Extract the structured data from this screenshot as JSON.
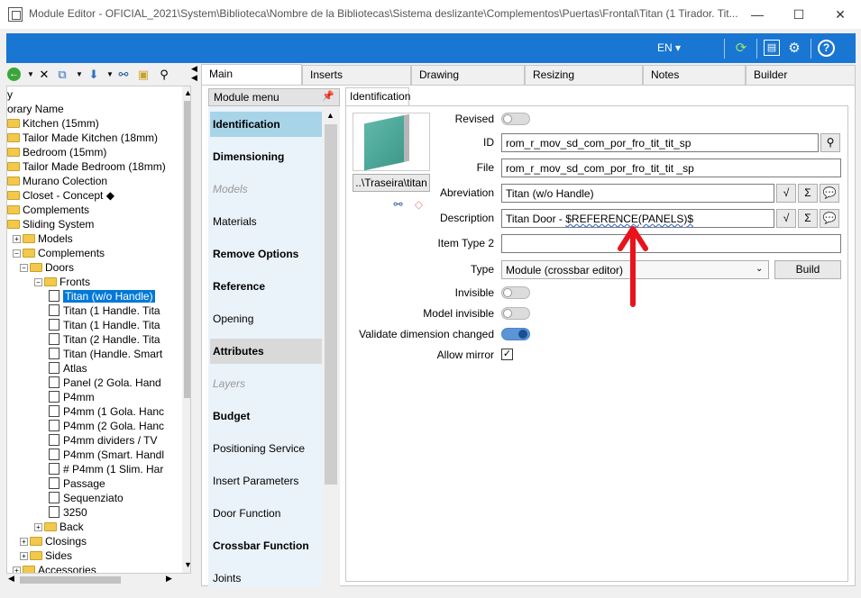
{
  "window": {
    "title": "Module Editor - OFICIAL_2021\\System\\Biblioteca\\Nombre de la Bibliotecas\\Sistema deslizante\\Complementos\\Puertas\\Frontal\\Titan (1 Tirador. Tit...",
    "minimize": "—",
    "maximize": "☐",
    "close": "✕"
  },
  "ribbon": {
    "language": "EN ▾",
    "refresh_icon": "refresh-icon",
    "layout_icon": "layout-icon",
    "settings_icon": "gears-icon",
    "help_icon": "help-icon"
  },
  "left_toolbar": {
    "icons": [
      "back-arrow-icon",
      "dropdown-icon",
      "delete-icon",
      "copy-icon",
      "dropdown-icon",
      "move-down-icon",
      "dropdown-icon",
      "binoculars-icon",
      "folder-refresh-icon",
      "tree-icon"
    ]
  },
  "tree": {
    "items": [
      {
        "label": "y",
        "indent": 0,
        "icon": "none"
      },
      {
        "label": "orary Name",
        "indent": 0,
        "icon": "none"
      },
      {
        "label": "Kitchen (15mm)",
        "indent": 0,
        "icon": "folder"
      },
      {
        "label": "Tailor Made Kitchen (18mm)",
        "indent": 0,
        "icon": "folder"
      },
      {
        "label": "Bedroom (15mm)",
        "indent": 0,
        "icon": "folder"
      },
      {
        "label": "Tailor Made Bedroom (18mm)",
        "indent": 0,
        "icon": "folder"
      },
      {
        "label": "Murano Colection",
        "indent": 0,
        "icon": "folder"
      },
      {
        "label": "Closet - Concept ◆",
        "indent": 0,
        "icon": "folder"
      },
      {
        "label": "Complements",
        "indent": 0,
        "icon": "folder"
      },
      {
        "label": "Sliding System",
        "indent": 0,
        "icon": "folder"
      },
      {
        "label": "Models",
        "indent": 1,
        "icon": "folder",
        "exp": "+"
      },
      {
        "label": "Complements",
        "indent": 1,
        "icon": "folder",
        "exp": "−"
      },
      {
        "label": "Doors",
        "indent": 2,
        "icon": "folder",
        "exp": "−"
      },
      {
        "label": "Fronts",
        "indent": 3,
        "icon": "folder",
        "exp": "−"
      },
      {
        "label": "Titan (w/o Handle)",
        "indent": 4,
        "icon": "doc",
        "selected": true
      },
      {
        "label": "Titan (1 Handle. Tita",
        "indent": 4,
        "icon": "doc"
      },
      {
        "label": "Titan (1 Handle. Tita",
        "indent": 4,
        "icon": "doc"
      },
      {
        "label": "Titan (2 Handle. Tita",
        "indent": 4,
        "icon": "doc"
      },
      {
        "label": "Titan (Handle. Smart",
        "indent": 4,
        "icon": "doc"
      },
      {
        "label": "Atlas",
        "indent": 4,
        "icon": "doc"
      },
      {
        "label": "Panel (2 Gola. Hand",
        "indent": 4,
        "icon": "doc"
      },
      {
        "label": "P4mm",
        "indent": 4,
        "icon": "doc"
      },
      {
        "label": "P4mm (1 Gola. Hanc",
        "indent": 4,
        "icon": "doc"
      },
      {
        "label": "P4mm (2 Gola. Hanc",
        "indent": 4,
        "icon": "doc"
      },
      {
        "label": "P4mm dividers / TV",
        "indent": 4,
        "icon": "doc"
      },
      {
        "label": "P4mm (Smart. Handl",
        "indent": 4,
        "icon": "doc"
      },
      {
        "label": "# P4mm (1 Slim. Har",
        "indent": 4,
        "icon": "doc"
      },
      {
        "label": "Passage",
        "indent": 4,
        "icon": "doc"
      },
      {
        "label": "Sequenziato",
        "indent": 4,
        "icon": "doc"
      },
      {
        "label": "3250",
        "indent": 4,
        "icon": "doc"
      },
      {
        "label": "Back",
        "indent": 3,
        "icon": "folder",
        "exp": "+"
      },
      {
        "label": "Closings",
        "indent": 2,
        "icon": "folder",
        "exp": "+"
      },
      {
        "label": "Sides",
        "indent": 2,
        "icon": "folder",
        "exp": "+"
      },
      {
        "label": "Accessories",
        "indent": 1,
        "icon": "folder",
        "exp": "+"
      }
    ]
  },
  "main_tabs": [
    "Main",
    "Inserts",
    "Drawing",
    "Resizing",
    "Notes",
    "Builder"
  ],
  "module_menu": {
    "header": "Module menu",
    "pin": "ꟷ",
    "items": [
      {
        "label": "Identification",
        "style": "bold",
        "state": "active"
      },
      {
        "label": "Dimensioning",
        "style": "bold"
      },
      {
        "label": "Models",
        "style": "italic"
      },
      {
        "label": "Materials",
        "style": "normal"
      },
      {
        "label": "Remove Options",
        "style": "bold"
      },
      {
        "label": "Reference",
        "style": "bold"
      },
      {
        "label": "Opening",
        "style": "normal"
      },
      {
        "label": "Attributes",
        "style": "bold",
        "state": "shaded"
      },
      {
        "label": "Layers",
        "style": "italic"
      },
      {
        "label": "Budget",
        "style": "bold"
      },
      {
        "label": "Positioning Service",
        "style": "normal"
      },
      {
        "label": "Insert Parameters",
        "style": "normal"
      },
      {
        "label": "Door Function",
        "style": "normal"
      },
      {
        "label": "Crossbar Function",
        "style": "bold"
      },
      {
        "label": "Joints",
        "style": "normal"
      }
    ]
  },
  "identification": {
    "tab": "Identification",
    "image_button": "..\\Traseira\\titan",
    "fields": {
      "revised_label": "Revised",
      "id_label": "ID",
      "id_value": "rom_r_mov_sd_com_por_fro_tit_tit_sp",
      "file_label": "File",
      "file_value": "rom_r_mov_sd_com_por_fro_tit_tit _sp",
      "abbrev_label": "Abreviation",
      "abbrev_value": "Titan (w/o Handle)",
      "desc_label": "Description",
      "desc_prefix": "Titan Door - ",
      "desc_ref": "$REFERENCE(PANELS)$",
      "itemtype_label": "Item Type 2",
      "itemtype_value": "",
      "type_label": "Type",
      "type_value": "Module (crossbar editor)",
      "build_button": "Build",
      "invisible_label": "Invisible",
      "model_invisible_label": "Model invisible",
      "validate_label": "Validate dimension changed",
      "mirror_label": "Allow mirror"
    },
    "toggles": {
      "revised": false,
      "invisible": false,
      "model_invisible": false,
      "validate": true
    },
    "allow_mirror": true,
    "sigma": "Σ"
  },
  "colors": {
    "ribbon": "#1976d2",
    "selection": "#0078d7",
    "active_menu": "#a8d4e8",
    "arrow": "#e8141c"
  }
}
